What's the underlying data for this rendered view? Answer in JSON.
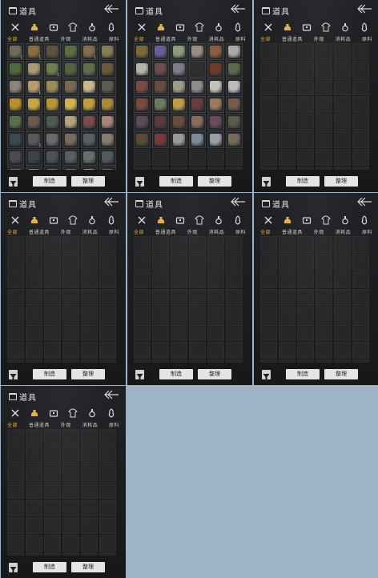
{
  "header": {
    "title": "道具"
  },
  "tabs": [
    "全部",
    "普通道具",
    "外观",
    "消耗品",
    "原料"
  ],
  "active_tab": 0,
  "footer": {
    "make_label": "制造",
    "sort_label": "整理"
  },
  "panels": [
    {
      "id": "p1",
      "cells": 48,
      "items": [
        {
          "c": "#6f6a5a",
          "q": "1"
        },
        {
          "c": "#8a6a3c",
          "q": "1"
        },
        {
          "c": "#5b4d3a",
          "q": ""
        },
        {
          "c": "#5a6b3a",
          "q": ""
        },
        {
          "c": "#7b6d48",
          "q": "1"
        },
        {
          "c": "#8a7a52",
          "q": ""
        },
        {
          "c": "#4d6b3a",
          "q": ""
        },
        {
          "c": "#a79a70",
          "q": ""
        },
        {
          "c": "#6b7b4c",
          "q": "1"
        },
        {
          "c": "#525e3a",
          "q": ""
        },
        {
          "c": "#5e6b48",
          "q": ""
        },
        {
          "c": "#6a5a3a",
          "q": ""
        },
        {
          "c": "#8c8476",
          "q": ""
        },
        {
          "c": "#b59d6a",
          "q": "1"
        },
        {
          "c": "#9a8a5a",
          "q": ""
        },
        {
          "c": "#7a6648",
          "q": ""
        },
        {
          "c": "#c7b88a",
          "q": ""
        },
        {
          "c": "#5b5b52",
          "q": ""
        },
        {
          "c": "#b9902c",
          "q": ""
        },
        {
          "c": "#c9a640",
          "q": ""
        },
        {
          "c": "#b79532",
          "q": ""
        },
        {
          "c": "#d4b04a",
          "q": ""
        },
        {
          "c": "#c09c38",
          "q": ""
        },
        {
          "c": "#a88a30",
          "q": ""
        },
        {
          "c": "#5a6e4a",
          "q": ""
        },
        {
          "c": "#6e5a4a",
          "q": ""
        },
        {
          "c": "#4a5a4e",
          "q": ""
        },
        {
          "c": "#b2a37a",
          "q": ""
        },
        {
          "c": "#7a4a4a",
          "q": ""
        },
        {
          "c": "#a8847a",
          "q": ""
        },
        {
          "c": "#3a4a52",
          "q": ""
        },
        {
          "c": "#5a5a5a",
          "q": "2"
        },
        {
          "c": "#6a6a6a",
          "q": ""
        },
        {
          "c": "#7a6a5a",
          "q": ""
        },
        {
          "c": "#595e6a",
          "q": ""
        },
        {
          "c": "#8a7a6a",
          "q": ""
        },
        {
          "c": "#4a4a52",
          "q": ""
        },
        {
          "c": "#3e4248",
          "q": ""
        },
        {
          "c": "#4e5258",
          "q": ""
        },
        {
          "c": "#5a5e62",
          "q": ""
        },
        {
          "c": "#6a6e6e",
          "q": ""
        },
        {
          "c": "#4e5a5e",
          "q": ""
        },
        {
          "c": "#7a6a9a",
          "q": ""
        },
        {
          "c": "#9a8a6a",
          "q": ""
        },
        {
          "c": "#8a7a5a",
          "q": ""
        },
        {
          "c": "#6a7a6a",
          "q": ""
        },
        {
          "c": "#9a9a9a",
          "q": ""
        },
        {
          "c": "#7a6a5a",
          "q": ""
        }
      ]
    },
    {
      "id": "p2",
      "cells": 48,
      "items": [
        {
          "c": "#7a6a3a",
          "q": ""
        },
        {
          "c": "#6a5a9a",
          "q": ""
        },
        {
          "c": "#8a9a7a",
          "q": ""
        },
        {
          "c": "#9a8a7a",
          "q": ""
        },
        {
          "c": "#8a5a3a",
          "q": ""
        },
        {
          "c": "#aaaaaa",
          "q": ""
        },
        {
          "c": "#b7b4ac",
          "q": ""
        },
        {
          "c": "#6a4a4a",
          "q": ""
        },
        {
          "c": "#7a7a8a",
          "q": ""
        },
        {
          "c": "#2a2a2a",
          "q": ""
        },
        {
          "c": "#6a3a2a",
          "q": ""
        },
        {
          "c": "#5a6a4a",
          "q": ""
        },
        {
          "c": "#7a4a4a",
          "q": ""
        },
        {
          "c": "#6a4a3a",
          "q": ""
        },
        {
          "c": "#9a9a8a",
          "q": ""
        },
        {
          "c": "#8a8a8a",
          "q": ""
        },
        {
          "c": "#c2c2b8",
          "q": ""
        },
        {
          "c": "#bcbcbc",
          "q": ""
        },
        {
          "c": "#7a4a3a",
          "q": ""
        },
        {
          "c": "#6a7a5a",
          "q": ""
        },
        {
          "c": "#c09c48",
          "q": ""
        },
        {
          "c": "#6a3a3a",
          "q": ""
        },
        {
          "c": "#9a7a5a",
          "q": ""
        },
        {
          "c": "#7a5a4a",
          "q": ""
        },
        {
          "c": "#5a4a5a",
          "q": ""
        },
        {
          "c": "#5a3a3a",
          "q": ""
        },
        {
          "c": "#6a4a3a",
          "q": ""
        },
        {
          "c": "#8a6a5a",
          "q": ""
        },
        {
          "c": "#6a4a5a",
          "q": ""
        },
        {
          "c": "#5a5a4a",
          "q": ""
        },
        {
          "c": "#5a4a3a",
          "q": ""
        },
        {
          "c": "#7a3a3a",
          "q": ""
        },
        {
          "c": "#9a9a9a",
          "q": ""
        },
        {
          "c": "#7a8a9a",
          "q": ""
        },
        {
          "c": "#9aa0aa",
          "q": ""
        },
        {
          "c": "#7a6a5a",
          "q": ""
        },
        null,
        null,
        null,
        null,
        null,
        null,
        null,
        null,
        null,
        null,
        null,
        null
      ]
    },
    {
      "id": "p3",
      "cells": 48,
      "items": []
    },
    {
      "id": "p4",
      "cells": 48,
      "items": []
    },
    {
      "id": "p5",
      "cells": 48,
      "items": []
    },
    {
      "id": "p6",
      "cells": 48,
      "items": []
    },
    {
      "id": "p7",
      "cells": 48,
      "items": []
    }
  ],
  "colors": {
    "accent_tab": "#e4b04a",
    "bg": "#9fb3c6",
    "panel": "#1c1e20"
  }
}
